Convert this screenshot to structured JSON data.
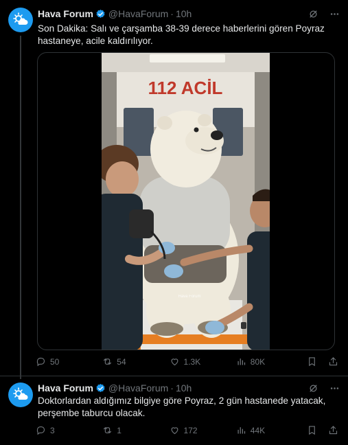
{
  "tweets": [
    {
      "author": "Hava Forum",
      "handle": "@HavaForum",
      "time": "10h",
      "text": "Son Dakika: Salı ve çarşamba 38-39 derece haberlerini gören Poyraz hastaneye, acile kaldırılıyor.",
      "media": {
        "ambulance_sign": "112 ACİL",
        "watermark": "Hava Forum"
      },
      "stats": {
        "replies": "50",
        "retweets": "54",
        "likes": "1.3K",
        "views": "80K"
      }
    },
    {
      "author": "Hava Forum",
      "handle": "@HavaForum",
      "time": "10h",
      "text": "Doktorlardan aldığımız bilgiye göre Poyraz, 2 gün hastanede yatacak, perşembe taburcu olacak.",
      "stats": {
        "replies": "3",
        "retweets": "1",
        "likes": "172",
        "views": "44K"
      }
    }
  ],
  "separator": "·",
  "colors": {
    "accent": "#1d9bf0",
    "muted": "#71767b",
    "background": "#000000",
    "text": "#e7e9ea"
  }
}
